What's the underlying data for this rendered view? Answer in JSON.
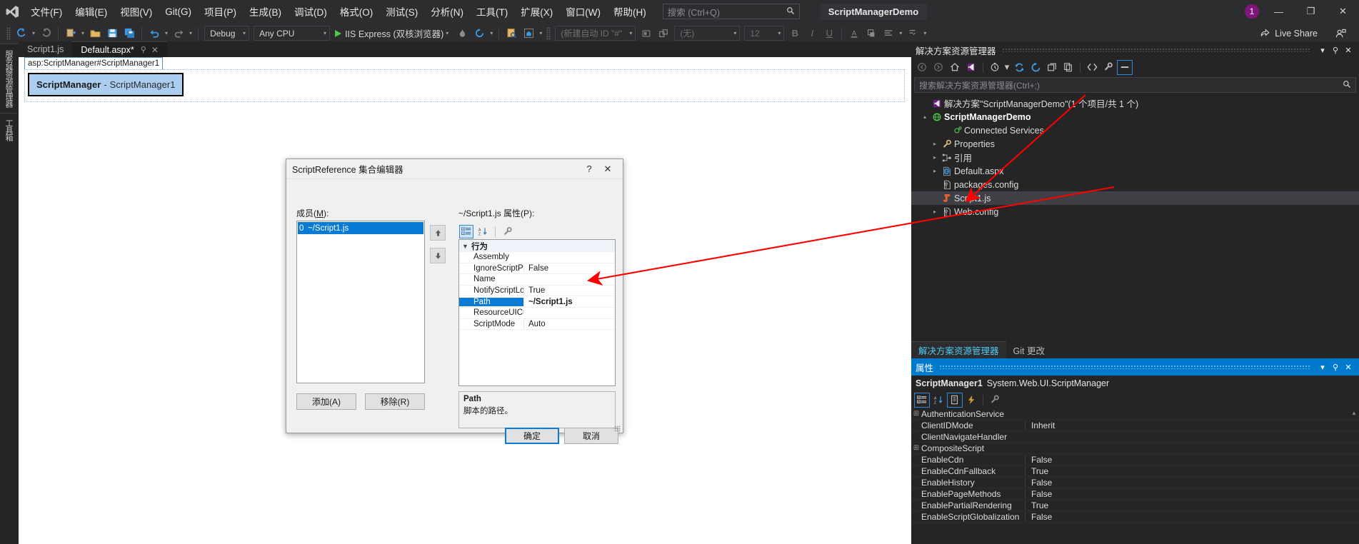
{
  "menubar": {
    "logo_icon": "visual-studio-logo",
    "items": [
      "文件(F)",
      "编辑(E)",
      "视图(V)",
      "Git(G)",
      "项目(P)",
      "生成(B)",
      "调试(D)",
      "格式(O)",
      "测试(S)",
      "分析(N)",
      "工具(T)",
      "扩展(X)",
      "窗口(W)",
      "帮助(H)"
    ],
    "search_placeholder": "搜索 (Ctrl+Q)",
    "search_icon": "search-icon",
    "project_name": "ScriptManagerDemo",
    "notification_count": "1",
    "minimize": "—",
    "restore": "❐",
    "close": "✕"
  },
  "toolbar": {
    "back_icon": "navigate-back-icon",
    "forward_icon": "navigate-forward-icon",
    "new_project_icon": "new-project-icon",
    "open_icon": "open-file-icon",
    "save_icon": "save-icon",
    "save_all_icon": "save-all-icon",
    "undo_icon": "undo-icon",
    "redo_icon": "redo-icon",
    "config": "Debug",
    "platform": "Any CPU",
    "run_target": "IIS Express (双核浏览器)",
    "hot_reload_icon": "hot-reload-icon",
    "refresh_icon": "refresh-icon",
    "file_find_icon": "file-find-icon",
    "home_icon": "home-icon",
    "id_combo": "(新建自动 ID \"#\"",
    "block_icon": "block-format-icon",
    "table_icon": "table-icon",
    "font_combo": "(无)",
    "size_combo": "12",
    "bold": "B",
    "italic": "I",
    "underline": "U",
    "fore_color_icon": "foreground-color-icon",
    "back_color_icon": "background-color-icon",
    "align_icon": "align-icon",
    "indent_icon": "indent-icon",
    "live_share": "Live Share",
    "live_share_icon": "live-share-icon",
    "live_share_people_icon": "live-share-people-icon"
  },
  "vertical_tabs": [
    "服务器资源管理器",
    "工具箱"
  ],
  "document_tabs": [
    {
      "label": "Script1.js",
      "active": false,
      "pin": "",
      "close": ""
    },
    {
      "label": "Default.aspx*",
      "active": true,
      "pin": "⚲",
      "close": "✕"
    }
  ],
  "designer": {
    "tag_path": "asp:ScriptManager#ScriptManager1",
    "control_name": "ScriptManager",
    "control_sep": "-",
    "control_id": "ScriptManager1"
  },
  "dialog": {
    "title": "ScriptReference 集合编辑器",
    "help_icon": "?",
    "close_icon": "✕",
    "members_label": "成员(M):",
    "members_label_plain": "成员",
    "members_accel": "M",
    "properties_label": "~/Script1.js 属性(P):",
    "members": [
      {
        "index": "0",
        "label": "~/Script1.js",
        "selected": true
      }
    ],
    "move_up_icon": "arrow-up-icon",
    "move_down_icon": "arrow-down-icon",
    "prop_toolbar": {
      "categorized_icon": "categorized-view-icon",
      "alphabetical_icon": "alphabetical-sort-icon",
      "property_pages_icon": "property-pages-icon"
    },
    "property_category": "行为",
    "properties": [
      {
        "name": "Assembly",
        "value": "",
        "selected": false
      },
      {
        "name": "IgnoreScriptPath",
        "value": "False",
        "selected": false
      },
      {
        "name": "Name",
        "value": "",
        "selected": false
      },
      {
        "name": "NotifyScriptLoaded",
        "value": "True",
        "selected": false
      },
      {
        "name": "Path",
        "value": "~/Script1.js",
        "selected": true
      },
      {
        "name": "ResourceUICultures",
        "value": "",
        "selected": false
      },
      {
        "name": "ScriptMode",
        "value": "Auto",
        "selected": false
      }
    ],
    "description_title": "Path",
    "description_text": "脚本的路径。",
    "add_button": "添加(A)",
    "remove_button": "移除(R)",
    "ok_button": "确定",
    "cancel_button": "取消"
  },
  "solution_explorer": {
    "title": "解决方案资源管理器",
    "dropdown_icon": "▾",
    "pin_icon": "⚲",
    "close_icon": "✕",
    "toolbar_icons": [
      "back-icon",
      "forward-icon",
      "home-icon",
      "solution-icon",
      "pending-changes-icon",
      "sync-icon",
      "refresh-icon",
      "collapse-all-icon",
      "show-all-files-icon",
      "view-code-icon",
      "properties-icon",
      "preview-icon"
    ],
    "search_placeholder": "搜索解决方案资源管理器(Ctrl+;)",
    "search_icon": "search-icon",
    "tree": [
      {
        "label": "解决方案\"ScriptManagerDemo\"(1 个项目/共 1 个)",
        "icon": "solution-icon",
        "indent": 0,
        "arrow": "",
        "bold": false,
        "selected": false
      },
      {
        "label": "ScriptManagerDemo",
        "icon": "web-project-icon",
        "indent": 1,
        "arrow": "▴",
        "bold": true,
        "selected": false
      },
      {
        "label": "Connected Services",
        "icon": "connected-services-icon",
        "indent": 2,
        "arrow": "",
        "bold": false,
        "selected": false
      },
      {
        "label": "Properties",
        "icon": "wrench-icon",
        "indent": 2,
        "arrow": "▸",
        "bold": false,
        "selected": false
      },
      {
        "label": "引用",
        "icon": "references-icon",
        "indent": 2,
        "arrow": "▸",
        "bold": false,
        "selected": false
      },
      {
        "label": "Default.aspx",
        "icon": "aspx-file-icon",
        "indent": 2,
        "arrow": "▸",
        "bold": false,
        "selected": false
      },
      {
        "label": "packages.config",
        "icon": "config-file-icon",
        "indent": 2,
        "arrow": "",
        "bold": false,
        "selected": false
      },
      {
        "label": "Script1.js",
        "icon": "js-file-icon",
        "indent": 2,
        "arrow": "",
        "bold": false,
        "selected": true
      },
      {
        "label": "Web.config",
        "icon": "config-file-icon",
        "indent": 2,
        "arrow": "▸",
        "bold": false,
        "selected": false
      }
    ],
    "bottom_tabs": [
      {
        "label": "解决方案资源管理器",
        "active": true
      },
      {
        "label": "Git 更改",
        "active": false
      }
    ]
  },
  "properties_panel": {
    "title": "属性",
    "dropdown_icon": "▾",
    "pin_icon": "⚲",
    "close_icon": "✕",
    "object_name": "ScriptManager1",
    "object_type": "System.Web.UI.ScriptManager",
    "toolbar_icons": [
      "categorized-view-icon",
      "alphabetical-sort-icon",
      "properties-icon",
      "events-icon",
      "property-pages-icon"
    ],
    "rows": [
      {
        "expander": "⊞",
        "name": "AuthenticationService",
        "value": ""
      },
      {
        "expander": "",
        "name": "ClientIDMode",
        "value": "Inherit"
      },
      {
        "expander": "",
        "name": "ClientNavigateHandler",
        "value": ""
      },
      {
        "expander": "⊞",
        "name": "CompositeScript",
        "value": ""
      },
      {
        "expander": "",
        "name": "EnableCdn",
        "value": "False"
      },
      {
        "expander": "",
        "name": "EnableCdnFallback",
        "value": "True"
      },
      {
        "expander": "",
        "name": "EnableHistory",
        "value": "False"
      },
      {
        "expander": "",
        "name": "EnablePageMethods",
        "value": "False"
      },
      {
        "expander": "",
        "name": "EnablePartialRendering",
        "value": "True"
      },
      {
        "expander": "",
        "name": "EnableScriptGlobalization",
        "value": "False"
      }
    ]
  },
  "colors": {
    "accent": "#007acc",
    "selection": "#0a7bd5",
    "annotation_arrow": "#ff0000",
    "chrome_bg": "#2d2d30",
    "panel_bg": "#252526"
  }
}
